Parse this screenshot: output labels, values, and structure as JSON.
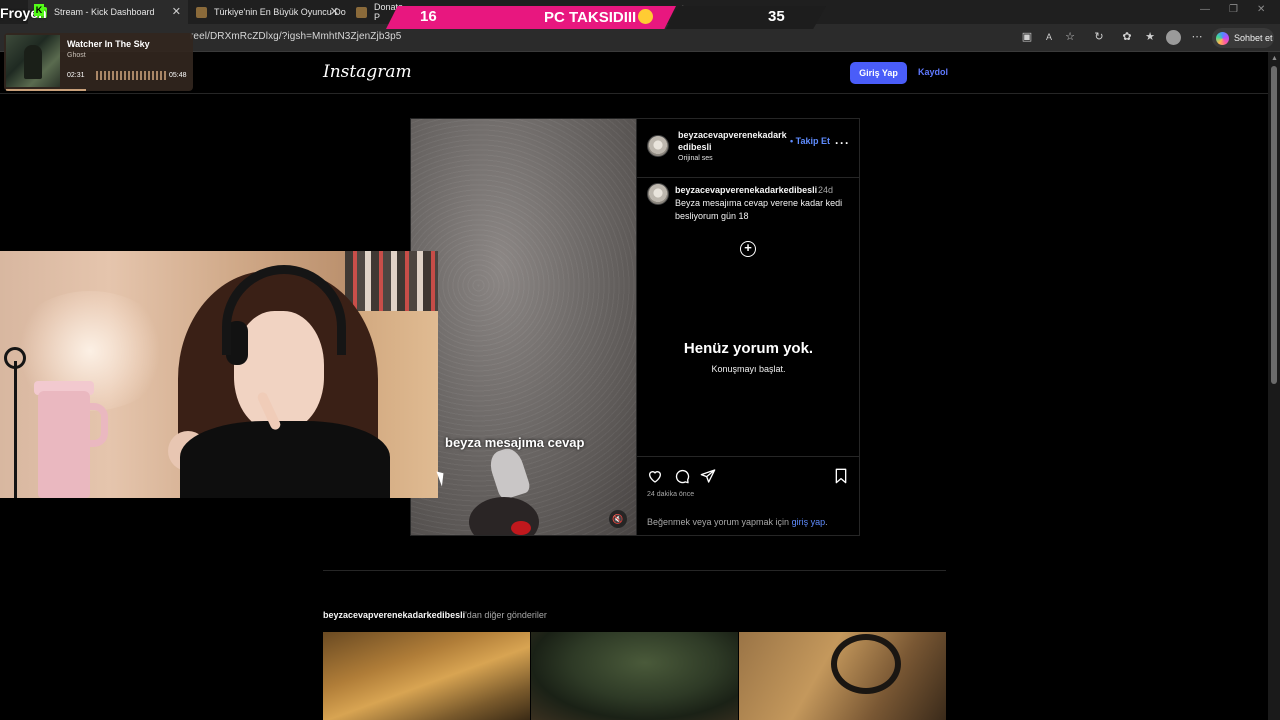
{
  "browser": {
    "tabs": [
      {
        "label": "Stream - Kick Dashboard",
        "favicon_color": "#53fc18"
      },
      {
        "label": "Türkiye'nin En Büyük Oyuncu Do",
        "favicon_color": "#8a6a3a"
      },
      {
        "label": "Donate P",
        "favicon_color": "#8a6a3a"
      }
    ],
    "url": "reel/DRXmRcZDlxg/?igsh=MmhtN3ZjenZjb3p5",
    "chat_button": "Sohbet et",
    "icons": [
      "split-screen-icon",
      "read-aloud-icon",
      "favorite-star-icon",
      "refresh-extension-icon",
      "extensions-icon",
      "favorites-icon",
      "profile-icon",
      "more-icon"
    ]
  },
  "overlay": {
    "channel": "Froyen",
    "score_left": "16",
    "score_title": "PC TAKSIDIII",
    "score_right": "35",
    "music": {
      "title": "Watcher In The Sky",
      "artist": "Ghost",
      "elapsed": "02:31",
      "duration": "05:48",
      "progress": 0.43
    }
  },
  "instagram": {
    "logo": "Instagram",
    "login": "Giriş Yap",
    "signup": "Kaydol",
    "post": {
      "username": "beyzacevapverenekadarkedibesli",
      "follow": "Takip Et",
      "audio": "Orijinal ses",
      "caption_user": "beyzacevapverenekadarkedibesli",
      "caption_time": "24d",
      "caption_text": "Beyza mesajıma cevap verene kadar kedi besliyorum gün 18",
      "video_caption": "beyza mesajıma cevap",
      "empty_title": "Henüz yorum yok.",
      "empty_sub": "Konuşmayı başlat.",
      "time_ago": "24 dakika önce",
      "login_prompt": "Beğenmek veya yorum yapmak için",
      "login_link": "giriş yap",
      "login_end": "."
    },
    "more_posts": {
      "user": "beyzacevapverenekadarkedibesli",
      "suffix": "'dan diğer gönderiler"
    }
  }
}
